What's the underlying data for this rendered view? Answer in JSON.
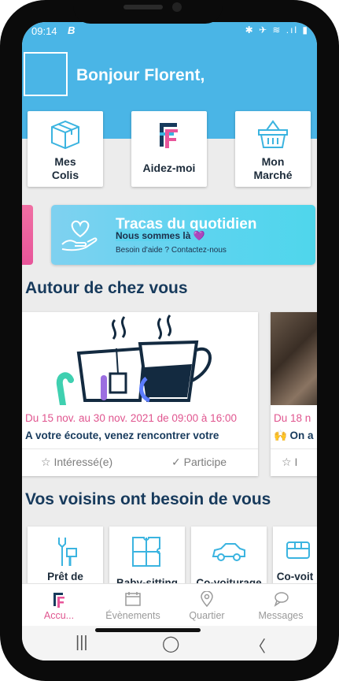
{
  "status": {
    "time": "09:14",
    "app_badge": "B",
    "icons": "✱ ✈ ≋ .ıl ▮"
  },
  "header": {
    "greeting": "Bonjour Florent,"
  },
  "quick_actions": [
    {
      "label_line1": "Mes",
      "label_line2": "Colis",
      "icon": "box-icon"
    },
    {
      "label_line1": "Aidez-moi",
      "label_line2": "",
      "icon": "brand-logo-icon"
    },
    {
      "label_line1": "Mon",
      "label_line2": "Marché",
      "icon": "basket-icon"
    }
  ],
  "banner": {
    "title": "Tracas du quotidien",
    "subtitle": "Nous sommes là 💜",
    "caption": "Besoin d'aide ? Contactez-nous",
    "icon": "heart-hand-icon"
  },
  "section_nearby": {
    "title": "Autour de chez vous"
  },
  "events": [
    {
      "date": "Du 15 nov. au 30 nov. 2021 de 09:00 à 16:00",
      "title": "A votre écoute, venez rencontrer votre",
      "interested_label": "Intéressé(e)",
      "participate_label": "Participe"
    },
    {
      "date": "Du 18 n",
      "title": "🙌 On a",
      "interested_label": "I",
      "participate_label": ""
    }
  ],
  "section_neighbors": {
    "title": "Vos voisins ont besoin de vous"
  },
  "needs": [
    {
      "label": "Prêt de",
      "icon": "tools-icon"
    },
    {
      "label": "Baby-sitting",
      "icon": "puzzle-icon"
    },
    {
      "label": "Co-voiturage",
      "icon": "car-icon"
    },
    {
      "label": "Co-voit",
      "icon": "bus-icon"
    }
  ],
  "tabs": [
    {
      "label": "Accu...",
      "icon": "brand-logo-icon",
      "active": true
    },
    {
      "label": "Évènements",
      "icon": "calendar-icon",
      "active": false
    },
    {
      "label": "Quartier",
      "icon": "map-pin-icon",
      "active": false
    },
    {
      "label": "Messages",
      "icon": "chat-icon",
      "active": false
    }
  ],
  "system_nav": {
    "recents": "|||",
    "home": "◯",
    "back": "〈"
  },
  "colors": {
    "primary": "#4ab5e6",
    "accent_pink": "#e0558f",
    "navy": "#173a5c",
    "banner": "#5cd4ef"
  }
}
